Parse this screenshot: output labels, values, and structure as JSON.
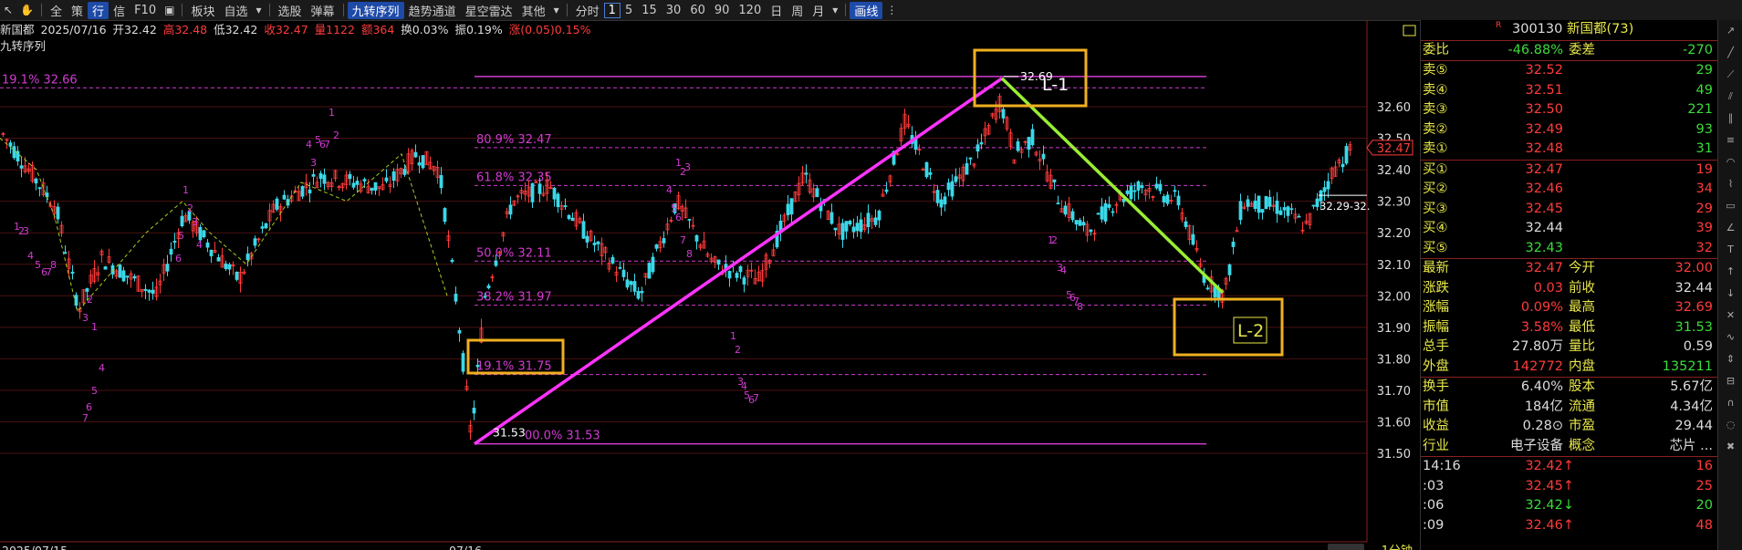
{
  "toolbar": {
    "items": [
      "全",
      "策",
      "行",
      "信",
      "F10",
      "板块",
      "自选",
      "选股",
      "弹幕",
      "九转序列",
      "趋势通道",
      "星空雷达",
      "其他",
      "分时",
      "1",
      "5",
      "15",
      "30",
      "60",
      "90",
      "120",
      "日",
      "周",
      "月",
      "画线"
    ]
  },
  "info": {
    "name": "新国都",
    "date": "2025/07/16",
    "open": "开32.42",
    "high": "高32.48",
    "low": "低32.42",
    "close": "收32.47",
    "volume": "量1122",
    "amount": "额364",
    "turnover": "换0.03%",
    "amplitude": "振0.19%",
    "change": "涨(0.05)0.15%"
  },
  "indicator": "九转序列",
  "chart_data": {
    "type": "candlestick",
    "period": "1分钟",
    "y_ticks": [
      "32.60",
      "32.50",
      "32.40",
      "32.30",
      "32.20",
      "32.10",
      "32.00",
      "31.90",
      "31.80",
      "31.70",
      "31.60",
      "31.50"
    ],
    "x_labels": [
      "2025/07/15",
      "07/16"
    ],
    "last_price": "32.47",
    "range_label": "32.29-32.",
    "fib_levels": [
      {
        "label": "19.1% 32.66",
        "price": 32.66
      },
      {
        "label": "80.9% 32.47",
        "price": 32.47
      },
      {
        "label": "61.8% 32.35",
        "price": 32.35
      },
      {
        "label": "50.0% 32.11",
        "price": 32.11
      },
      {
        "label": "38.2% 31.97",
        "price": 31.97
      },
      {
        "label": "19.1% 31.75",
        "price": 31.75
      },
      {
        "label": "00.0% 31.53",
        "price": 31.53
      }
    ],
    "peak": {
      "label": "32.69",
      "price": 32.69
    },
    "trough": {
      "label": "31.53",
      "price": 31.53
    },
    "annotations": [
      "L-1",
      "L-2"
    ],
    "sequence_numbers": [
      "1",
      "2",
      "3",
      "4",
      "5",
      "6",
      "7",
      "8",
      "9"
    ]
  },
  "colors": {
    "up": "#ff3b3b",
    "down": "#3bd8e8",
    "fib": "#d23bd2",
    "trend_up": "#ff33ff",
    "trend_down": "#99ee33",
    "highlight_box": "#f0b020"
  },
  "quote": {
    "code": "300130",
    "name": "新国都(73)",
    "r_mark": "R",
    "wb": {
      "label": "委比",
      "value": "-46.88%",
      "label2": "委差",
      "value2": "-270"
    },
    "sells": [
      {
        "label": "卖⑤",
        "price": "32.52",
        "vol": "29"
      },
      {
        "label": "卖④",
        "price": "32.51",
        "vol": "49"
      },
      {
        "label": "卖③",
        "price": "32.50",
        "vol": "221"
      },
      {
        "label": "卖②",
        "price": "32.49",
        "vol": "93"
      },
      {
        "label": "卖①",
        "price": "32.48",
        "vol": "31"
      }
    ],
    "buys": [
      {
        "label": "买①",
        "price": "32.47",
        "vol": "19"
      },
      {
        "label": "买②",
        "price": "32.46",
        "vol": "34"
      },
      {
        "label": "买③",
        "price": "32.45",
        "vol": "29"
      },
      {
        "label": "买④",
        "price": "32.44",
        "vol": "39"
      },
      {
        "label": "买⑤",
        "price": "32.43",
        "vol": "32"
      }
    ],
    "stats": [
      {
        "l1": "最新",
        "v1": "32.47",
        "l2": "今开",
        "v2": "32.00"
      },
      {
        "l1": "涨跌",
        "v1": "0.03",
        "l2": "前收",
        "v2": "32.44"
      },
      {
        "l1": "涨幅",
        "v1": "0.09%",
        "l2": "最高",
        "v2": "32.69"
      },
      {
        "l1": "振幅",
        "v1": "3.58%",
        "l2": "最低",
        "v2": "31.53"
      },
      {
        "l1": "总手",
        "v1": "27.80万",
        "l2": "量比",
        "v2": "0.59"
      },
      {
        "l1": "外盘",
        "v1": "142772",
        "l2": "内盘",
        "v2": "135211"
      }
    ],
    "stats2": [
      {
        "l1": "换手",
        "v1": "6.40%",
        "l2": "股本",
        "v2": "5.67亿"
      },
      {
        "l1": "市值",
        "v1": "184亿",
        "l2": "流通",
        "v2": "4.34亿"
      },
      {
        "l1": "收益",
        "v1": "0.28⊙",
        "l2": "市盈",
        "v2": "29.44"
      },
      {
        "l1": "行业",
        "v1": "电子设备",
        "l2": "概念",
        "v2": "芯片 ..."
      }
    ],
    "ticks": [
      {
        "time": "14:16",
        "price": "32.42↑",
        "vol": "16"
      },
      {
        "time": ":03",
        "price": "32.45↑",
        "vol": "25"
      },
      {
        "time": ":06",
        "price": "32.42↓",
        "vol": "20"
      },
      {
        "time": ":09",
        "price": "32.46↑",
        "vol": "48"
      }
    ]
  }
}
